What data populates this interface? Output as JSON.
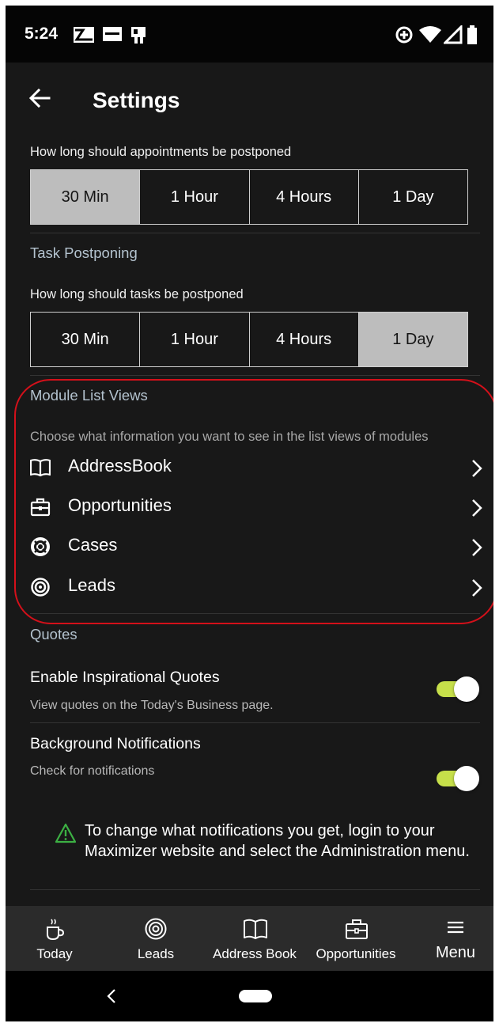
{
  "status_bar": {
    "time": "5:24",
    "left_icons": [
      "notification-icon",
      "sonos-icon",
      "phone-icon"
    ],
    "right_icons": [
      "data-saver-icon",
      "wifi-icon",
      "signal-icon",
      "battery-icon"
    ]
  },
  "header": {
    "title": "Settings",
    "back_icon": "arrow-left-icon"
  },
  "appointment_postponing": {
    "question": "How long should appointments be postponed",
    "options": [
      "30 Min",
      "1 Hour",
      "4 Hours",
      "1 Day"
    ],
    "selected": "30 Min"
  },
  "task_postponing": {
    "section_title": "Task Postponing",
    "question": "How long should tasks be postponed",
    "options": [
      "30 Min",
      "1 Hour",
      "4 Hours",
      "1 Day"
    ],
    "selected": "1 Day"
  },
  "module_list_views": {
    "section_title": "Module List Views",
    "description": "Choose what information you want to see in the list views of modules",
    "items": [
      {
        "label": "AddressBook",
        "icon": "book-icon"
      },
      {
        "label": "Opportunities",
        "icon": "briefcase-icon"
      },
      {
        "label": "Cases",
        "icon": "lifebuoy-icon"
      },
      {
        "label": "Leads",
        "icon": "target-icon"
      }
    ],
    "highlight_color": "#d4101a"
  },
  "quotes": {
    "section_title": "Quotes",
    "inspirational": {
      "title": "Enable Inspirational Quotes",
      "subtitle": "View quotes on the Today's Business page.",
      "enabled": true
    },
    "background_notifications": {
      "title": "Background Notifications",
      "subtitle": "Check for notifications",
      "enabled": true
    },
    "notice": "To change what notifications you get, login to your Maximizer website and select the Administration menu.",
    "notice_icon": "warning-triangle-icon"
  },
  "bottom_nav": {
    "items": [
      {
        "label": "Today",
        "icon": "coffee-cup-icon"
      },
      {
        "label": "Leads",
        "icon": "target-icon"
      },
      {
        "label": "Address Book",
        "icon": "book-icon"
      },
      {
        "label": "Opportunities",
        "icon": "briefcase-icon"
      },
      {
        "label": "Menu",
        "icon": "hamburger-icon"
      }
    ]
  },
  "colors": {
    "background": "#181818",
    "accent_toggle": "#c6df4a",
    "selected_segment": "#bdbdbd",
    "section_title": "#b4c3cf",
    "warning": "#3cb043"
  }
}
